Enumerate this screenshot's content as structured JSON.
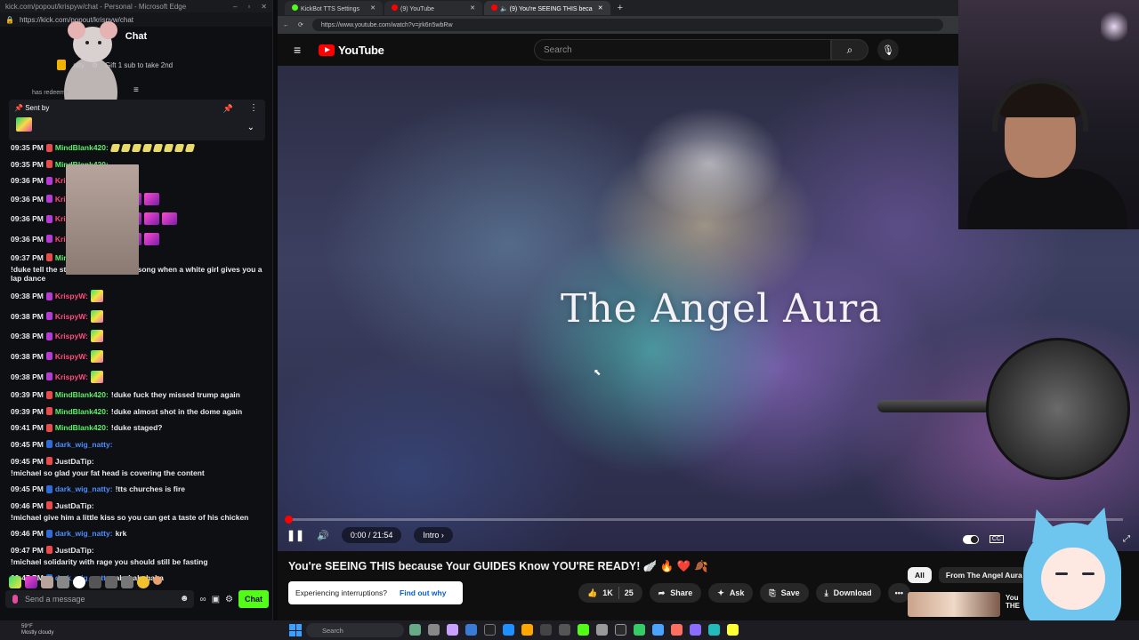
{
  "chat_window": {
    "title_bar": "kick.com/popout/krispyw/chat - Personal - Microsoft Edge",
    "url": "https://kick.com/popout/krispyw/chat",
    "heading": "Chat",
    "gift_text": "Gift 1 sub to take 2nd",
    "gift_user_fragment": "atty",
    "redeem_fragment": "has redeeme",
    "pinned_label": "Sent by",
    "messages": [
      {
        "time": "09:35 PM",
        "user": "MindBlank420:",
        "color": "#5ef06b",
        "text": "",
        "emotes": "flags"
      },
      {
        "time": "09:35 PM",
        "user": "MindBlank420:",
        "color": "#5ef06b",
        "text": "",
        "emotes": "hands"
      },
      {
        "time": "09:36 PM",
        "user": "KrispyW:",
        "color": "#ff4b7d",
        "text": "",
        "emotes": "rats"
      },
      {
        "time": "09:36 PM",
        "user": "KrispyW:",
        "color": "#ff4b7d",
        "text": "",
        "emotes": "pink3"
      },
      {
        "time": "09:36 PM",
        "user": "KrispyW:",
        "color": "#ff4b7d",
        "text": "",
        "emotes": "pink5"
      },
      {
        "time": "09:36 PM",
        "user": "KrispyW:",
        "color": "#ff4b7d",
        "text": "",
        "emotes": "pink4"
      },
      {
        "time": "09:37 PM",
        "user": "MindBlank420:",
        "color": "#5ef06b",
        "text": "!duke tell the strip club to play this song when a white girl gives you a lap dance",
        "emotes": ""
      },
      {
        "time": "09:38 PM",
        "user": "KrispyW:",
        "color": "#ff4b7d",
        "text": "",
        "emotes": "w"
      },
      {
        "time": "09:38 PM",
        "user": "KrispyW:",
        "color": "#ff4b7d",
        "text": "",
        "emotes": "w"
      },
      {
        "time": "09:38 PM",
        "user": "KrispyW:",
        "color": "#ff4b7d",
        "text": "",
        "emotes": "w"
      },
      {
        "time": "09:38 PM",
        "user": "KrispyW:",
        "color": "#ff4b7d",
        "text": "",
        "emotes": "w"
      },
      {
        "time": "09:38 PM",
        "user": "KrispyW:",
        "color": "#ff4b7d",
        "text": "",
        "emotes": "w"
      },
      {
        "time": "09:39 PM",
        "user": "MindBlank420:",
        "color": "#5ef06b",
        "text": "!duke fuck they missed trump again",
        "emotes": ""
      },
      {
        "time": "09:39 PM",
        "user": "MindBlank420:",
        "color": "#5ef06b",
        "text": "!duke almost shot in the dome again",
        "emotes": ""
      },
      {
        "time": "09:41 PM",
        "user": "MindBlank420:",
        "color": "#5ef06b",
        "text": "!duke staged?",
        "emotes": ""
      },
      {
        "time": "09:45 PM",
        "user": "dark_wig_natty:",
        "color": "#4d8dff",
        "text": "",
        "emotes": "face"
      },
      {
        "time": "09:45 PM",
        "user": "JustDaTip:",
        "color": "#e9e9ee",
        "text": "!michael so glad your fat head is covering the content",
        "emotes": ""
      },
      {
        "time": "09:45 PM",
        "user": "dark_wig_natty:",
        "color": "#4d8dff",
        "text": "!tts churches is fire",
        "emotes": ""
      },
      {
        "time": "09:46 PM",
        "user": "JustDaTip:",
        "color": "#e9e9ee",
        "text": "!michael give him a little kiss so you can get a taste of his chicken",
        "emotes": ""
      },
      {
        "time": "09:46 PM",
        "user": "dark_wig_natty:",
        "color": "#4d8dff",
        "text": "krk",
        "emotes": ""
      },
      {
        "time": "09:47 PM",
        "user": "JustDaTip:",
        "color": "#e9e9ee",
        "text": "!michael solidarity with rage you should still be fasting",
        "emotes": ""
      },
      {
        "time": "09:47 PM",
        "user": "dark_wig_natty:",
        "color": "#4d8dff",
        "text": "ahahahahaha",
        "emotes": ""
      }
    ],
    "send_placeholder": "Send a message",
    "chat_button": "Chat",
    "loop_icon_text": "∞"
  },
  "browser": {
    "tabs": [
      {
        "label": "KickBot TTS Settings",
        "fav_color": "#53fc18"
      },
      {
        "label": "(9) YouTube",
        "fav_color": "#ff0000"
      },
      {
        "label": "(9) You're SEEING THIS beca",
        "fav_color": "#ff0000"
      }
    ],
    "url": "https://www.youtube.com/watch?v=jrk6n5wbRw",
    "logo_text": "YouTube",
    "search_placeholder": "Search",
    "video": {
      "overlay_title": "The Angel Aura",
      "time": "0:00 / 21:54",
      "chapter": "Intro",
      "progress": 0.005
    },
    "title": "You're SEEING THIS because Your GUIDES Know YOU'RE READY! 🪽 🔥 ❤️ 🍂",
    "interruption_text": "Experiencing interruptions?",
    "interruption_link": "Find out why",
    "actions": {
      "likes": "1K",
      "comments": "25",
      "share": "Share",
      "ask": "Ask",
      "save": "Save",
      "download": "Download"
    },
    "chips": [
      "All",
      "From The Angel Aura"
    ],
    "sidebar_fragment": "You",
    "sidebar_fragment2": "THE"
  },
  "taskbar": {
    "weather_temp": "59°F",
    "weather_text": "Mostly cloudy",
    "search": "Search"
  }
}
